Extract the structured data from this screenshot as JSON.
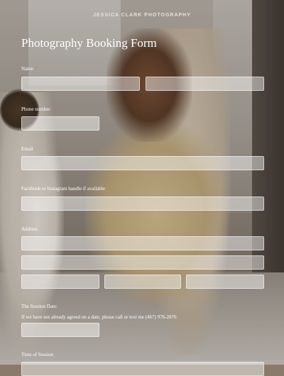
{
  "brand": "JESSICA CLARK PHOTOGRAPHY",
  "form": {
    "title": "Photography Booking Form",
    "name_label": "Name",
    "phone_label": "Phone number",
    "email_label": "Email",
    "social_label": "Facebook or Instagram handle if available",
    "address_label": "Address",
    "session_date_label": "The Session Date:",
    "session_date_note": "If we have not already agreed on a date, please call or text me (467) 976-2876",
    "session_time_label": "Time of Session",
    "required_mark": "*"
  },
  "colors": {
    "required": "#e06a6a",
    "field_fill": "rgba(255,255,255,0.45)"
  }
}
